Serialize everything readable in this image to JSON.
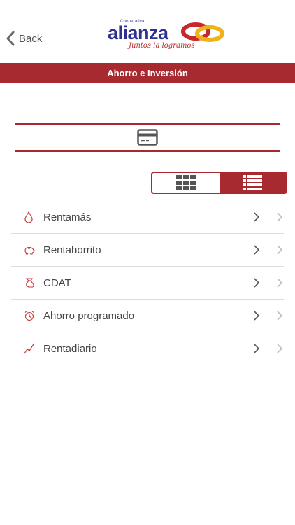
{
  "nav": {
    "back_label": "Back",
    "logo": {
      "small_text": "Cooperativa",
      "word": "alianza",
      "tagline": "Juntos la logramos"
    }
  },
  "title": "Ahorro e Inversión",
  "colors": {
    "accent": "#a82a31",
    "divider": "#dcdcdc",
    "text": "#444444"
  },
  "view_toggle": {
    "options": [
      "grid-view",
      "list-view"
    ],
    "selected": "list-view"
  },
  "products": [
    {
      "label": "Rentamás",
      "icon": "drop-icon"
    },
    {
      "label": "Rentahorrito",
      "icon": "piggy-bank-icon"
    },
    {
      "label": "CDAT",
      "icon": "money-bag-icon"
    },
    {
      "label": "Ahorro programado",
      "icon": "alarm-clock-icon"
    },
    {
      "label": "Rentadiario",
      "icon": "trend-line-icon"
    }
  ]
}
